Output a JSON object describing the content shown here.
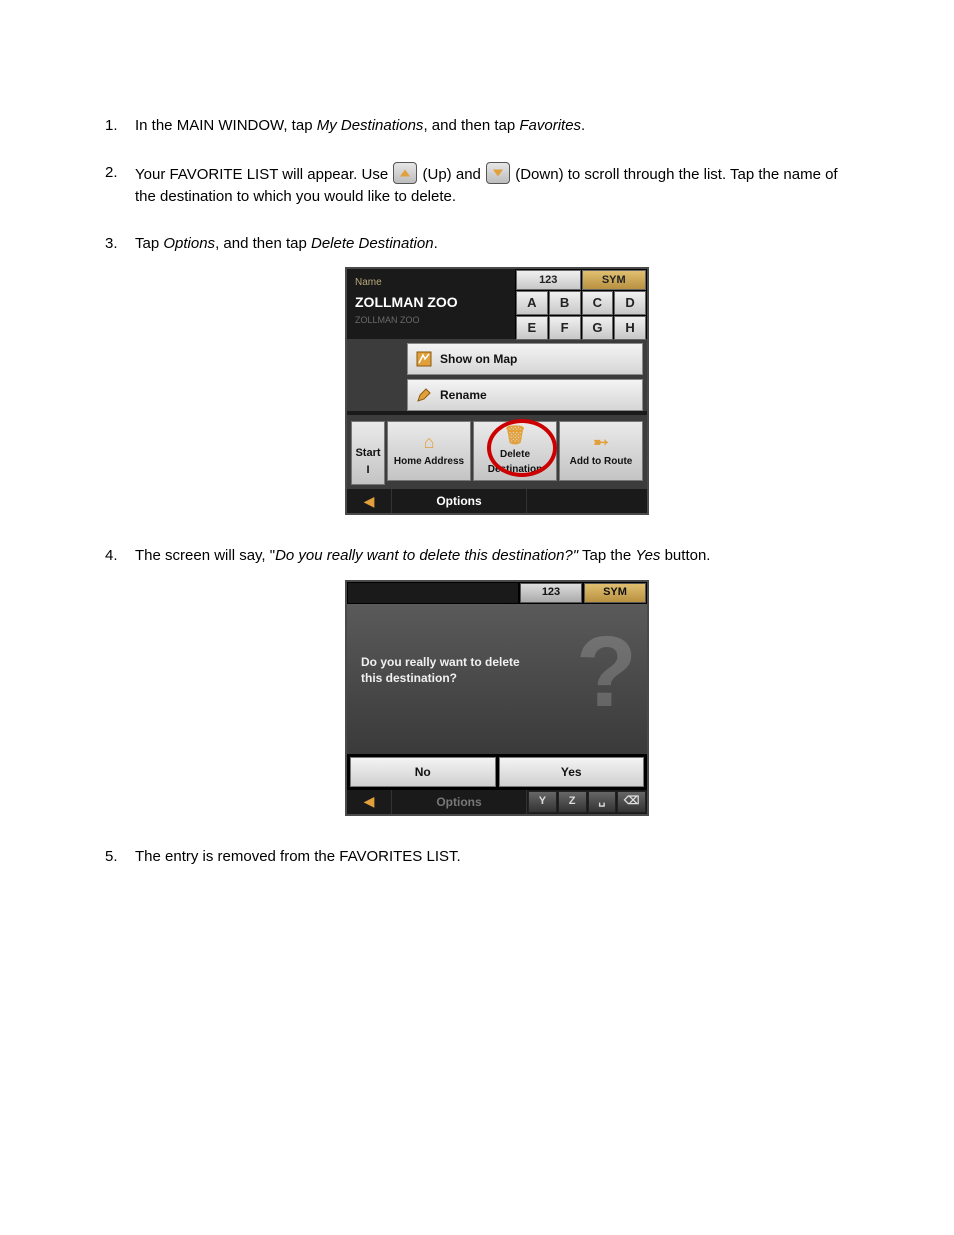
{
  "steps": {
    "s1": {
      "num": "1.",
      "t1": "In the MAIN WINDOW, tap ",
      "i1": "My Destinations",
      "t2": ", and then tap ",
      "i2": "Favorites",
      "t3": "."
    },
    "s2": {
      "num": "2.",
      "t1": "Your FAVORITE LIST will appear.  Use",
      "t2": " (Up) and ",
      "t3": " (Down) to scroll through the list.  Tap the name of the destination to which you would like to delete."
    },
    "s3": {
      "num": "3.",
      "t1": "Tap ",
      "i1": "Options",
      "t2": ", and then tap ",
      "i2": "Delete Destination",
      "t3": "."
    },
    "s4": {
      "num": "4.",
      "t1": "The screen will say, \"",
      "i1": "Do you really want to delete this destination?\"",
      "t2": "   Tap the ",
      "i2": "Yes",
      "t3": " button."
    },
    "s5": {
      "num": "5.",
      "t1": "The entry is removed from the FAVORITES LIST."
    }
  },
  "device1": {
    "name_label": "Name",
    "name_value": "ZOLLMAN ZOO",
    "name_ghost": "ZOLLMAN ZOO",
    "key_123": "123",
    "key_sym": "SYM",
    "keys": [
      "A",
      "B",
      "C",
      "D",
      "E",
      "F",
      "G",
      "H"
    ],
    "menu_show": "Show on Map",
    "menu_rename": "Rename",
    "btn_start": "Start I",
    "btn_home": "Home Address",
    "btn_delete_l1": "Delete",
    "btn_delete_l2": "Destination",
    "btn_addroute": "Add to Route",
    "footer_options": "Options"
  },
  "device2": {
    "tab_123": "123",
    "tab_sym": "SYM",
    "question_l1": "Do you really want to delete",
    "question_l2": "this destination?",
    "btn_no": "No",
    "btn_yes": "Yes",
    "footer_options": "Options",
    "mini_keys": [
      "Y",
      "Z",
      "␣",
      "⌫"
    ]
  }
}
